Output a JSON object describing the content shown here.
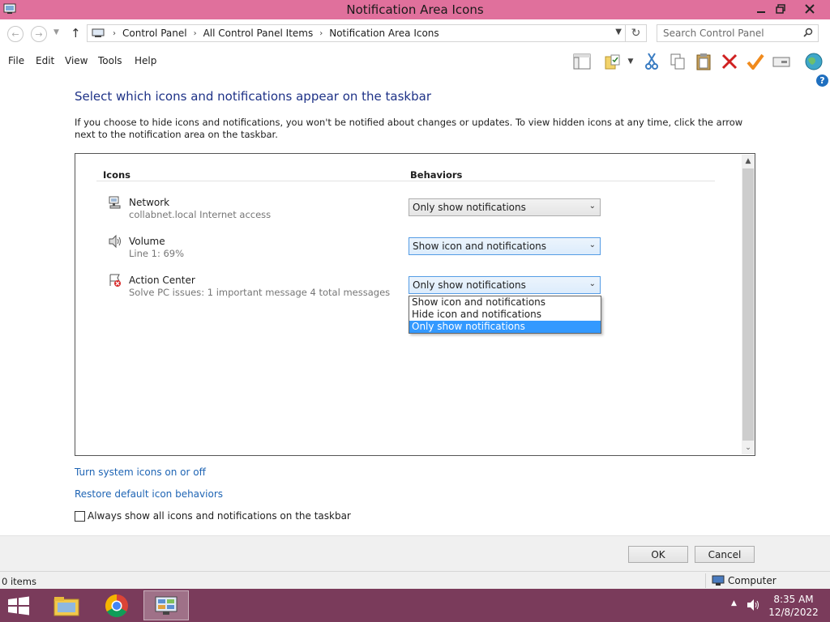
{
  "window": {
    "title": "Notification Area Icons",
    "title_bar_color": "#e0709c"
  },
  "address": {
    "breadcrumbs": [
      "Control Panel",
      "All Control Panel Items",
      "Notification Area Icons"
    ],
    "search_placeholder": "Search Control Panel"
  },
  "menu": {
    "items": [
      "File",
      "Edit",
      "View",
      "Tools",
      "Help"
    ]
  },
  "toolbar_icons": [
    "layout-icon",
    "folder-check-icon",
    "cut-icon",
    "copy-icon",
    "paste-icon",
    "delete-icon",
    "checkmark-icon",
    "properties-icon",
    "globe-icon"
  ],
  "content": {
    "title": "Select which icons and notifications appear on the taskbar",
    "description": "If you choose to hide icons and notifications, you won't be notified about changes or updates. To view hidden icons at any time, click the arrow next to the notification area on the taskbar.",
    "headers": {
      "icons": "Icons",
      "behaviors": "Behaviors"
    },
    "rows": [
      {
        "icon": "network-icon",
        "name": "Network",
        "description": "collabnet.local Internet access",
        "behavior": "Only show notifications"
      },
      {
        "icon": "volume-icon",
        "name": "Volume",
        "description": "Line 1: 69%",
        "behavior": "Show icon and notifications"
      },
      {
        "icon": "action-center-icon",
        "name": "Action Center",
        "description": "Solve PC issues: 1 important message  4 total messages",
        "behavior": "Only show notifications"
      }
    ],
    "dropdown_options": [
      "Show icon and notifications",
      "Hide icon and notifications",
      "Only show notifications"
    ],
    "dropdown_selected": "Only show notifications",
    "links": {
      "turn_system_icons": "Turn system icons on or off",
      "restore_default": "Restore default icon behaviors"
    },
    "always_show_label": "Always show all icons and notifications on the taskbar",
    "always_show_checked": false
  },
  "footer": {
    "ok": "OK",
    "cancel": "Cancel"
  },
  "status": {
    "items_count": "0 items",
    "location": "Computer"
  },
  "taskbar": {
    "color": "#7a3b5b",
    "apps": [
      "file-explorer-icon",
      "chrome-icon",
      "control-panel-icon"
    ],
    "time": "8:35 AM",
    "date": "12/8/2022"
  }
}
